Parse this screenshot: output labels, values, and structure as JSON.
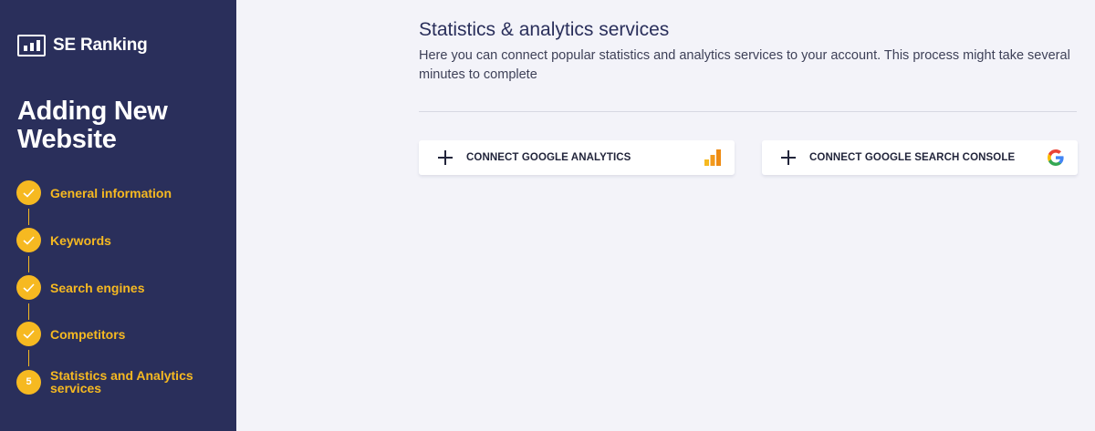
{
  "sidebar": {
    "logo_text": "SE Ranking",
    "title": "Adding New Website",
    "steps": [
      {
        "label": "General information",
        "status": "done"
      },
      {
        "label": "Keywords",
        "status": "done"
      },
      {
        "label": "Search engines",
        "status": "done"
      },
      {
        "label": "Competitors",
        "status": "done"
      },
      {
        "label": "Statistics and Analytics services",
        "status": "current",
        "number": "5"
      }
    ]
  },
  "main": {
    "title": "Statistics & analytics services",
    "description": "Here you can connect popular statistics and analytics services to your account. This process might take several minutes to complete",
    "cards": [
      {
        "label": "CONNECT GOOGLE ANALYTICS",
        "icon": "google-analytics-icon"
      },
      {
        "label": "CONNECT GOOGLE SEARCH CONSOLE",
        "icon": "google-icon"
      }
    ]
  },
  "colors": {
    "sidebar_bg": "#2a2f5b",
    "accent": "#f6b921",
    "page_bg": "#f3f3f9"
  }
}
